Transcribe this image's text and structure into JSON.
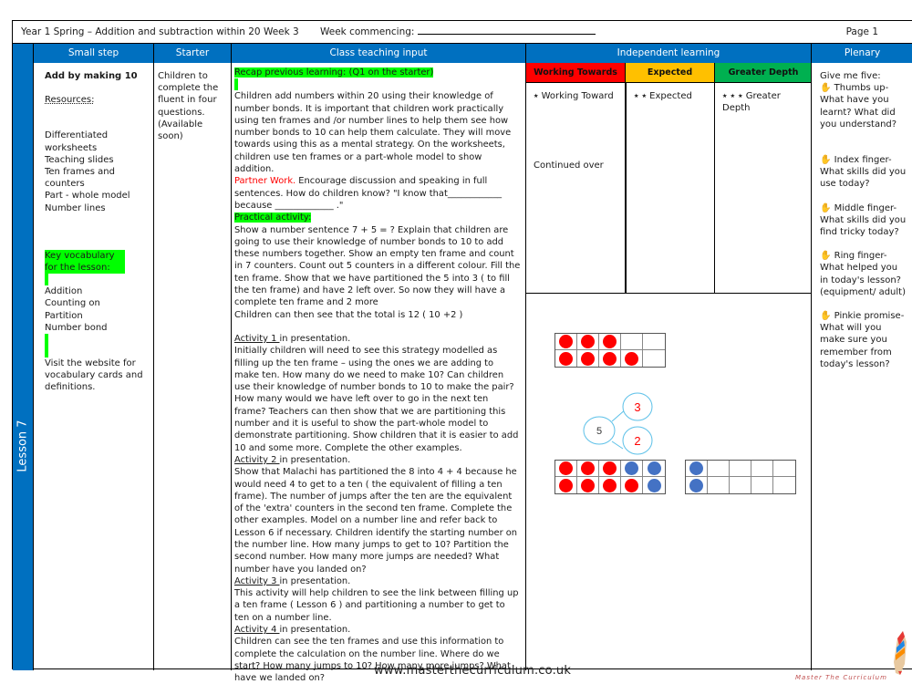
{
  "header": {
    "title": "Year 1 Spring – Addition and subtraction within 20 Week 3",
    "week_commencing_label": "Week commencing:",
    "page": "Page 1"
  },
  "columns": {
    "small_step": "Small step",
    "starter": "Starter",
    "class_teaching": "Class teaching input",
    "independent": "Independent learning",
    "plenary": "Plenary"
  },
  "lesson_label": "Lesson 7",
  "small_step": {
    "title": "Add by making 10",
    "resources_label": "Resources:",
    "resources": [
      "Differentiated worksheets",
      "Teaching slides",
      "Ten frames and counters",
      "Part - whole model",
      "Number lines"
    ],
    "vocab_heading": "Key vocabulary for the lesson:",
    "vocab": [
      "Addition",
      "Counting on",
      "Partition",
      "Number bond"
    ],
    "website_note": "Visit the website for vocabulary cards and definitions."
  },
  "starter": {
    "text": "Children to complete the fluent in four questions. (Available soon)"
  },
  "class_teaching": {
    "recap_heading": "Recap previous learning: (Q1 on the starter)",
    "recap_text": "Children add numbers within 20 using their knowledge of number bonds. It is important that children work practically using ten frames and /or number lines to help them see how number bonds to 10 can help them calculate. They will move towards using this as a mental strategy. On the worksheets, children use ten frames or  a part-whole model to show addition.",
    "partner_label": "Partner Work.",
    "partner_text": " Encourage discussion and speaking in full sentences. How do children know?  \"I know that____________ because _____________ .\"",
    "practical_heading": "Practical activity:",
    "practical_text": "Show  a number sentence   7 + 5  = ?  Explain that children are going to use their knowledge of number bonds to 10 to add these numbers together. Show an empty ten frame and count in 7 counters. Count out 5 counters in a different colour. Fill the ten frame. Show that we have partitioned the 5 into 3 ( to fill the ten frame) and have 2 left over.  So now they will have a complete ten frame and 2 more",
    "practical_total": "Children can then see that the total is 12 ( 10 +2 )",
    "activities": [
      {
        "label": "Activity 1 ",
        "suffix": "in presentation.",
        "text": "Initially children will need to see this strategy modelled as filling up the ten frame – using the ones we are adding to make ten. How many do we need to make 10? Can children use their knowledge of number bonds to 10 to make the pair? How many would we have left over to go in the next ten frame? Teachers can then show that we are partitioning this number and it is useful to show the  part-whole model to demonstrate partitioning. Show children that it is easier to add 10 and some more. Complete the other examples."
      },
      {
        "label": "Activity 2 ",
        "suffix": "in presentation.",
        "text": "Show that Malachi  has partitioned the 8 into 4 + 4 because he would need 4 to get to a ten ( the equivalent of filling a ten frame). The number of jumps after the ten are the equivalent of  the 'extra' counters in the second ten frame. Complete the other examples. Model on a number line and refer back to Lesson 6 if necessary. Children identify the starting number on the number line. How many jumps to get to 10? Partition the second number. How many more jumps are needed? What number have you landed on?"
      },
      {
        "label": "Activity 3 ",
        "suffix": "in presentation.",
        "text": "This activity will help children to see the link between filling up a ten frame  ( Lesson 6 ) and  partitioning a number to get to ten on a number line."
      },
      {
        "label": "Activity 4 ",
        "suffix": "in presentation.",
        "text": "Children can see the ten frames and use this information to complete the calculation on the number line. Where do we start? How many jumps to 10? How many more jumps? What have we landed on?"
      }
    ]
  },
  "independent": {
    "levels": [
      {
        "name": "Working Towards",
        "color": "#ff0000",
        "text": "⭑ Working Toward",
        "extra": "Continued over"
      },
      {
        "name": "Expected",
        "color": "#ffc000",
        "text": "⭑ ⭑ Expected"
      },
      {
        "name": "Greater Depth",
        "color": "#00b050",
        "text": "⭑ ⭑ ⭑ Greater Depth"
      }
    ],
    "diagram": {
      "frame_top": [
        "red",
        "red",
        "red",
        "empty",
        "empty",
        "red",
        "red",
        "red",
        "red",
        "empty"
      ],
      "part_whole": {
        "whole": "5",
        "parts": [
          "3",
          "2"
        ]
      },
      "frame_bottom_left": [
        "red",
        "red",
        "red",
        "blue",
        "blue",
        "red",
        "red",
        "red",
        "red",
        "blue"
      ],
      "frame_bottom_right": [
        "blue",
        "empty",
        "empty",
        "empty",
        "empty",
        "blue",
        "empty",
        "empty",
        "empty",
        "empty"
      ],
      "colors": {
        "red": "#ff0000",
        "blue": "#4472c4",
        "circle": "#5bc0e8"
      }
    }
  },
  "plenary": {
    "intro": "Give me five:",
    "items": [
      "✋ Thumbs up- What have you learnt? What did you understand?",
      "✋ Index finger- What skills did you use today?",
      "✋ Middle finger- What skills did you find tricky today?",
      "✋ Ring finger- What helped you in today's lesson? (equipment/ adult)",
      "✋ Pinkie promise- What will you make sure you remember from today's lesson?"
    ]
  },
  "footer": {
    "url": "www.masterthecurriculum.co.uk",
    "brand": "Master The Curriculum"
  }
}
